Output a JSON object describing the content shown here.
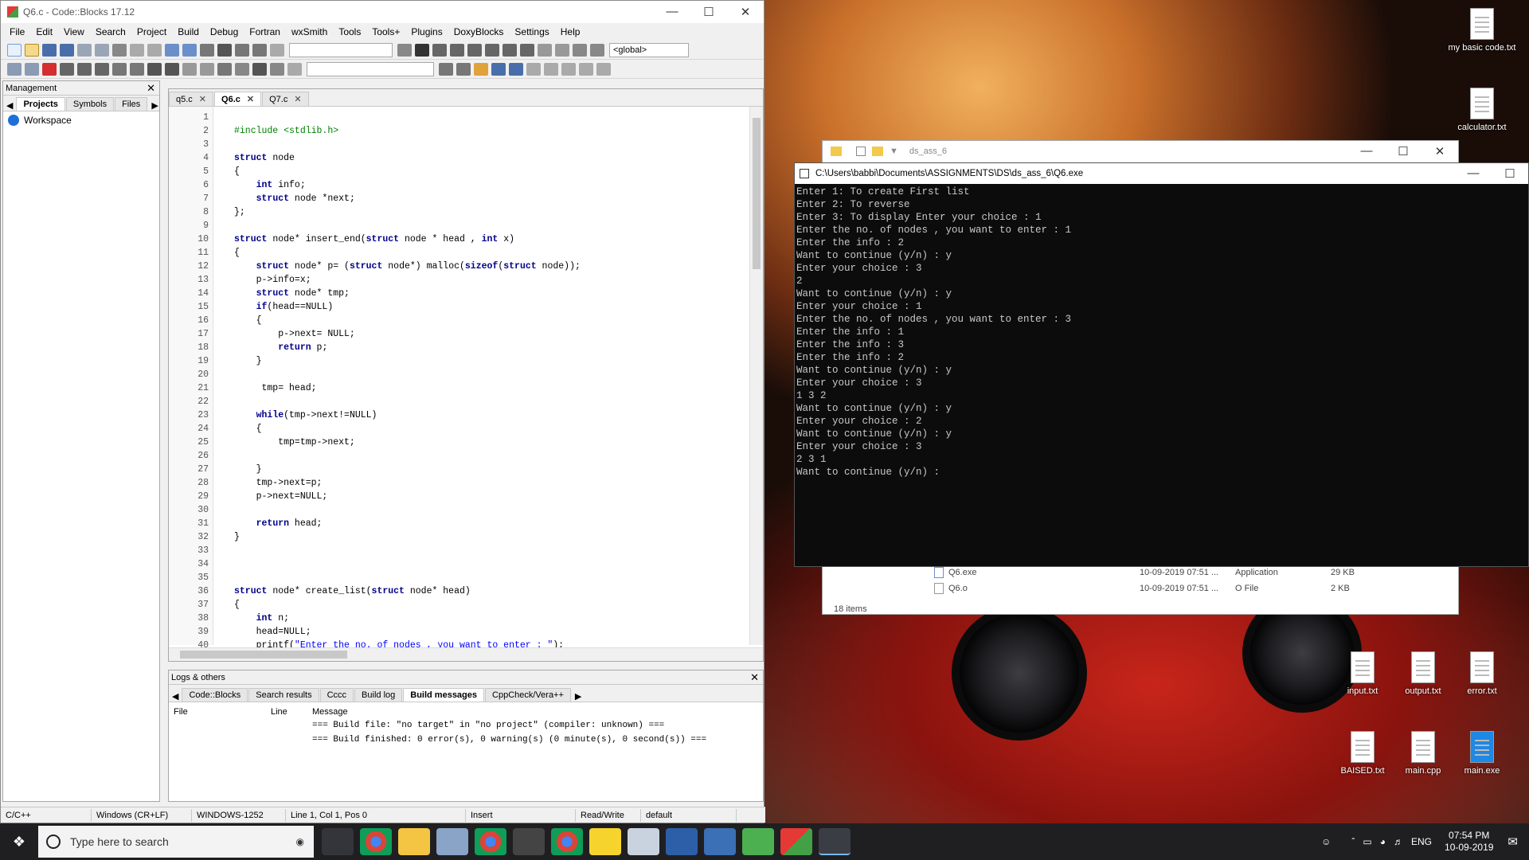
{
  "codeblocks": {
    "title": "Q6.c - Code::Blocks 17.12",
    "menus": [
      "File",
      "Edit",
      "View",
      "Search",
      "Project",
      "Build",
      "Debug",
      "Fortran",
      "wxSmith",
      "Tools",
      "Tools+",
      "Plugins",
      "DoxyBlocks",
      "Settings",
      "Help"
    ],
    "scope_combo": "<global>",
    "management": {
      "title": "Management",
      "tabs": [
        "Projects",
        "Symbols",
        "Files"
      ],
      "workspace": "Workspace"
    },
    "editor_tabs": [
      "q5.c",
      "Q6.c",
      "Q7.c"
    ],
    "code": [
      {
        "n": "1",
        "t": ""
      },
      {
        "n": "2",
        "t": "#include <stdlib.h>"
      },
      {
        "n": "3",
        "t": ""
      },
      {
        "n": "4",
        "t": "struct node"
      },
      {
        "n": "5",
        "t": "{"
      },
      {
        "n": "6",
        "t": "    int info;"
      },
      {
        "n": "7",
        "t": "    struct node *next;"
      },
      {
        "n": "8",
        "t": "};"
      },
      {
        "n": "9",
        "t": ""
      },
      {
        "n": "10",
        "t": "struct node* insert_end(struct node * head , int x)"
      },
      {
        "n": "11",
        "t": "{"
      },
      {
        "n": "12",
        "t": "    struct node* p= (struct node*) malloc(sizeof(struct node));"
      },
      {
        "n": "13",
        "t": "    p->info=x;"
      },
      {
        "n": "14",
        "t": "    struct node* tmp;"
      },
      {
        "n": "15",
        "t": "    if(head==NULL)"
      },
      {
        "n": "16",
        "t": "    {"
      },
      {
        "n": "17",
        "t": "        p->next= NULL;"
      },
      {
        "n": "18",
        "t": "        return p;"
      },
      {
        "n": "19",
        "t": "    }"
      },
      {
        "n": "20",
        "t": ""
      },
      {
        "n": "21",
        "t": "     tmp= head;"
      },
      {
        "n": "22",
        "t": ""
      },
      {
        "n": "23",
        "t": "    while(tmp->next!=NULL)"
      },
      {
        "n": "24",
        "t": "    {"
      },
      {
        "n": "25",
        "t": "        tmp=tmp->next;"
      },
      {
        "n": "26",
        "t": ""
      },
      {
        "n": "27",
        "t": "    }"
      },
      {
        "n": "28",
        "t": "    tmp->next=p;"
      },
      {
        "n": "29",
        "t": "    p->next=NULL;"
      },
      {
        "n": "30",
        "t": ""
      },
      {
        "n": "31",
        "t": "    return head;"
      },
      {
        "n": "32",
        "t": "}"
      },
      {
        "n": "33",
        "t": ""
      },
      {
        "n": "34",
        "t": ""
      },
      {
        "n": "35",
        "t": ""
      },
      {
        "n": "36",
        "t": "struct node* create_list(struct node* head)"
      },
      {
        "n": "37",
        "t": "{"
      },
      {
        "n": "38",
        "t": "    int n;"
      },
      {
        "n": "39",
        "t": "    head=NULL;"
      },
      {
        "n": "40",
        "t": "    printf(\"Enter the no. of nodes , you want to enter : \");"
      }
    ],
    "logs": {
      "title": "Logs & others",
      "tabs": [
        "Code::Blocks",
        "Search results",
        "Cccc",
        "Build log",
        "Build messages",
        "CppCheck/Vera++"
      ],
      "columns": [
        "File",
        "Line",
        "Message"
      ],
      "messages": [
        "=== Build file: \"no target\" in \"no project\" (compiler: unknown) ===",
        "=== Build finished: 0 error(s), 0 warning(s) (0 minute(s), 0 second(s)) ==="
      ]
    },
    "status": [
      "C/C++",
      "Windows (CR+LF)",
      "WINDOWS-1252",
      "Line 1, Col 1, Pos 0",
      "Insert",
      "Read/Write",
      "default"
    ]
  },
  "explorer": {
    "title": "ds_ass_6",
    "rows": [
      {
        "name": "Q6.exe",
        "date": "10-09-2019 07:51 ...",
        "type": "Application",
        "size": "29 KB"
      },
      {
        "name": "Q6.o",
        "date": "10-09-2019 07:51 ...",
        "type": "O File",
        "size": "2 KB"
      }
    ],
    "count": "18 items"
  },
  "console": {
    "title": "C:\\Users\\babbi\\Documents\\ASSIGNMENTS\\DS\\ds_ass_6\\Q6.exe",
    "lines": [
      "Enter 1: To create First list",
      "Enter 2: To reverse",
      "Enter 3: To display Enter your choice : 1",
      "Enter the no. of nodes , you want to enter : 1",
      "Enter the info : 2",
      "Want to continue (y/n) : y",
      "Enter your choice : 3",
      "2",
      "Want to continue (y/n) : y",
      "Enter your choice : 1",
      "Enter the no. of nodes , you want to enter : 3",
      "Enter the info : 1",
      "Enter the info : 3",
      "Enter the info : 2",
      "Want to continue (y/n) : y",
      "Enter your choice : 3",
      "1 3 2",
      "Want to continue (y/n) : y",
      "Enter your choice : 2",
      "Want to continue (y/n) : y",
      "Enter your choice : 3",
      "2 3 1",
      "Want to continue (y/n) :"
    ]
  },
  "desktop_icons": [
    {
      "label": "my basic code.txt"
    },
    {
      "label": "calculator.txt"
    },
    {
      "label": "input.txt"
    },
    {
      "label": "output.txt"
    },
    {
      "label": "error.txt"
    },
    {
      "label": "BAISED.txt"
    },
    {
      "label": "main.cpp"
    },
    {
      "label": "main.exe"
    }
  ],
  "taskbar": {
    "search_placeholder": "Type here to search",
    "lang": "ENG",
    "time": "07:54 PM",
    "date": "10-09-2019"
  }
}
